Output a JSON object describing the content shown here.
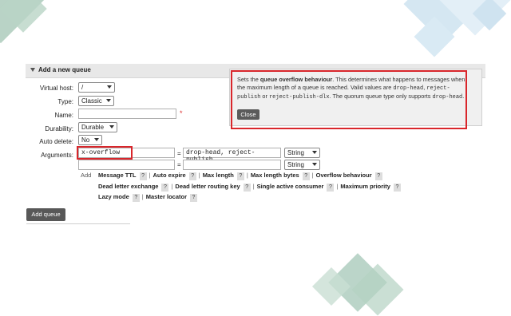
{
  "section": {
    "title": "Add a new queue"
  },
  "form": {
    "virtual_host": {
      "label": "Virtual host:",
      "value": "/"
    },
    "type": {
      "label": "Type:",
      "value": "Classic"
    },
    "name": {
      "label": "Name:",
      "value": "",
      "required_mark": "*"
    },
    "durability": {
      "label": "Durability:",
      "value": "Durable"
    },
    "auto_delete": {
      "label": "Auto delete:",
      "value": "No"
    },
    "arguments": {
      "label": "Arguments:",
      "rows": [
        {
          "key": "x-overflow",
          "equals": "=",
          "value": "drop-head, reject-publish",
          "type": "String"
        },
        {
          "key": "",
          "equals": "=",
          "value": "",
          "type": "String"
        }
      ]
    },
    "add_label": "Add",
    "hints": [
      "Message TTL",
      "Auto expire",
      "Max length",
      "Max length bytes",
      "Overflow behaviour",
      "Dead letter exchange",
      "Dead letter routing key",
      "Single active consumer",
      "Maximum priority",
      "Lazy mode",
      "Master locator"
    ],
    "hint_mark": "?",
    "separator": "|"
  },
  "tooltip": {
    "t1": "Sets the ",
    "b1": "queue overflow behaviour",
    "t2": ". This determines what happens to messages when the maximum length of a queue is reached. Valid values are ",
    "c1": "drop-head",
    "t3": ", ",
    "c2": "reject-publish",
    "t4": " or ",
    "c3": "reject-publish-dlx",
    "t5": ". The quorum queue type only supports ",
    "c4": "drop-head",
    "t6": ".",
    "close_label": "Close"
  },
  "add_queue_button": "Add queue"
}
